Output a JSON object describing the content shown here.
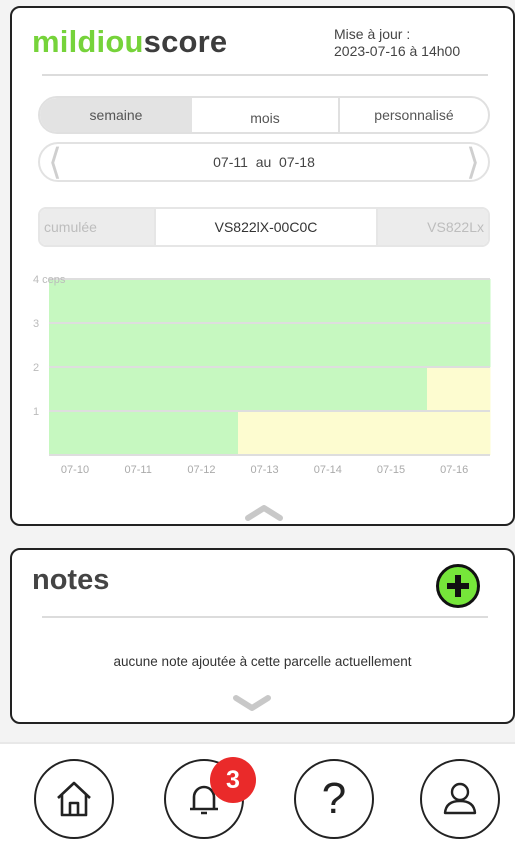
{
  "header": {
    "logo_part1": "mildiou",
    "logo_part2": "score",
    "update_label": "Mise à jour :",
    "update_value": "2023-07-16 à 14h00"
  },
  "period_tabs": {
    "items": [
      "semaine",
      "mois",
      "personnalisé"
    ],
    "selected": "semaine"
  },
  "date_range": {
    "from": "07-11",
    "sep": "au",
    "to": "07-18"
  },
  "selector": {
    "left": "cumulée",
    "current": "VS822lX-00C0C",
    "right": "VS822Lx"
  },
  "chart_data": {
    "type": "area",
    "ylabel": "",
    "y_ticks": [
      "1",
      "2",
      "3",
      "4 ceps"
    ],
    "ylim": [
      0,
      4
    ],
    "x_ticks": [
      "07-10",
      "07-11",
      "07-12",
      "07-13",
      "07-14",
      "07-15",
      "07-16"
    ],
    "series": [
      {
        "color": "#c6f8c0",
        "values": [
          1,
          1,
          1,
          0,
          0,
          0,
          0
        ]
      },
      {
        "color": "#fdfcd0",
        "values": [
          0,
          0,
          0,
          1,
          1,
          1,
          1
        ]
      },
      {
        "color": "#c6f8c0",
        "values": [
          1,
          1,
          1,
          1,
          1,
          1,
          0
        ]
      },
      {
        "color": "#fdfcd0",
        "values": [
          0,
          0,
          0,
          0,
          0,
          0,
          1
        ]
      },
      {
        "color": "#c6f8c0",
        "values": [
          2,
          2,
          2,
          2,
          2,
          2,
          2
        ]
      }
    ],
    "grid": true
  },
  "notes": {
    "title": "notes",
    "empty_message": "aucune note ajoutée à cette parcelle actuellement"
  },
  "bottom_nav": {
    "items": [
      "home-icon",
      "bell-icon",
      "help-icon",
      "user-icon"
    ],
    "help_glyph": "?",
    "badge": "3"
  },
  "colors": {
    "brand_green": "#76d33a",
    "add_button": "#76e63a",
    "badge_red": "#ea2a2a",
    "healthy": "#c6f8c0",
    "warning": "#fdfcd0"
  }
}
